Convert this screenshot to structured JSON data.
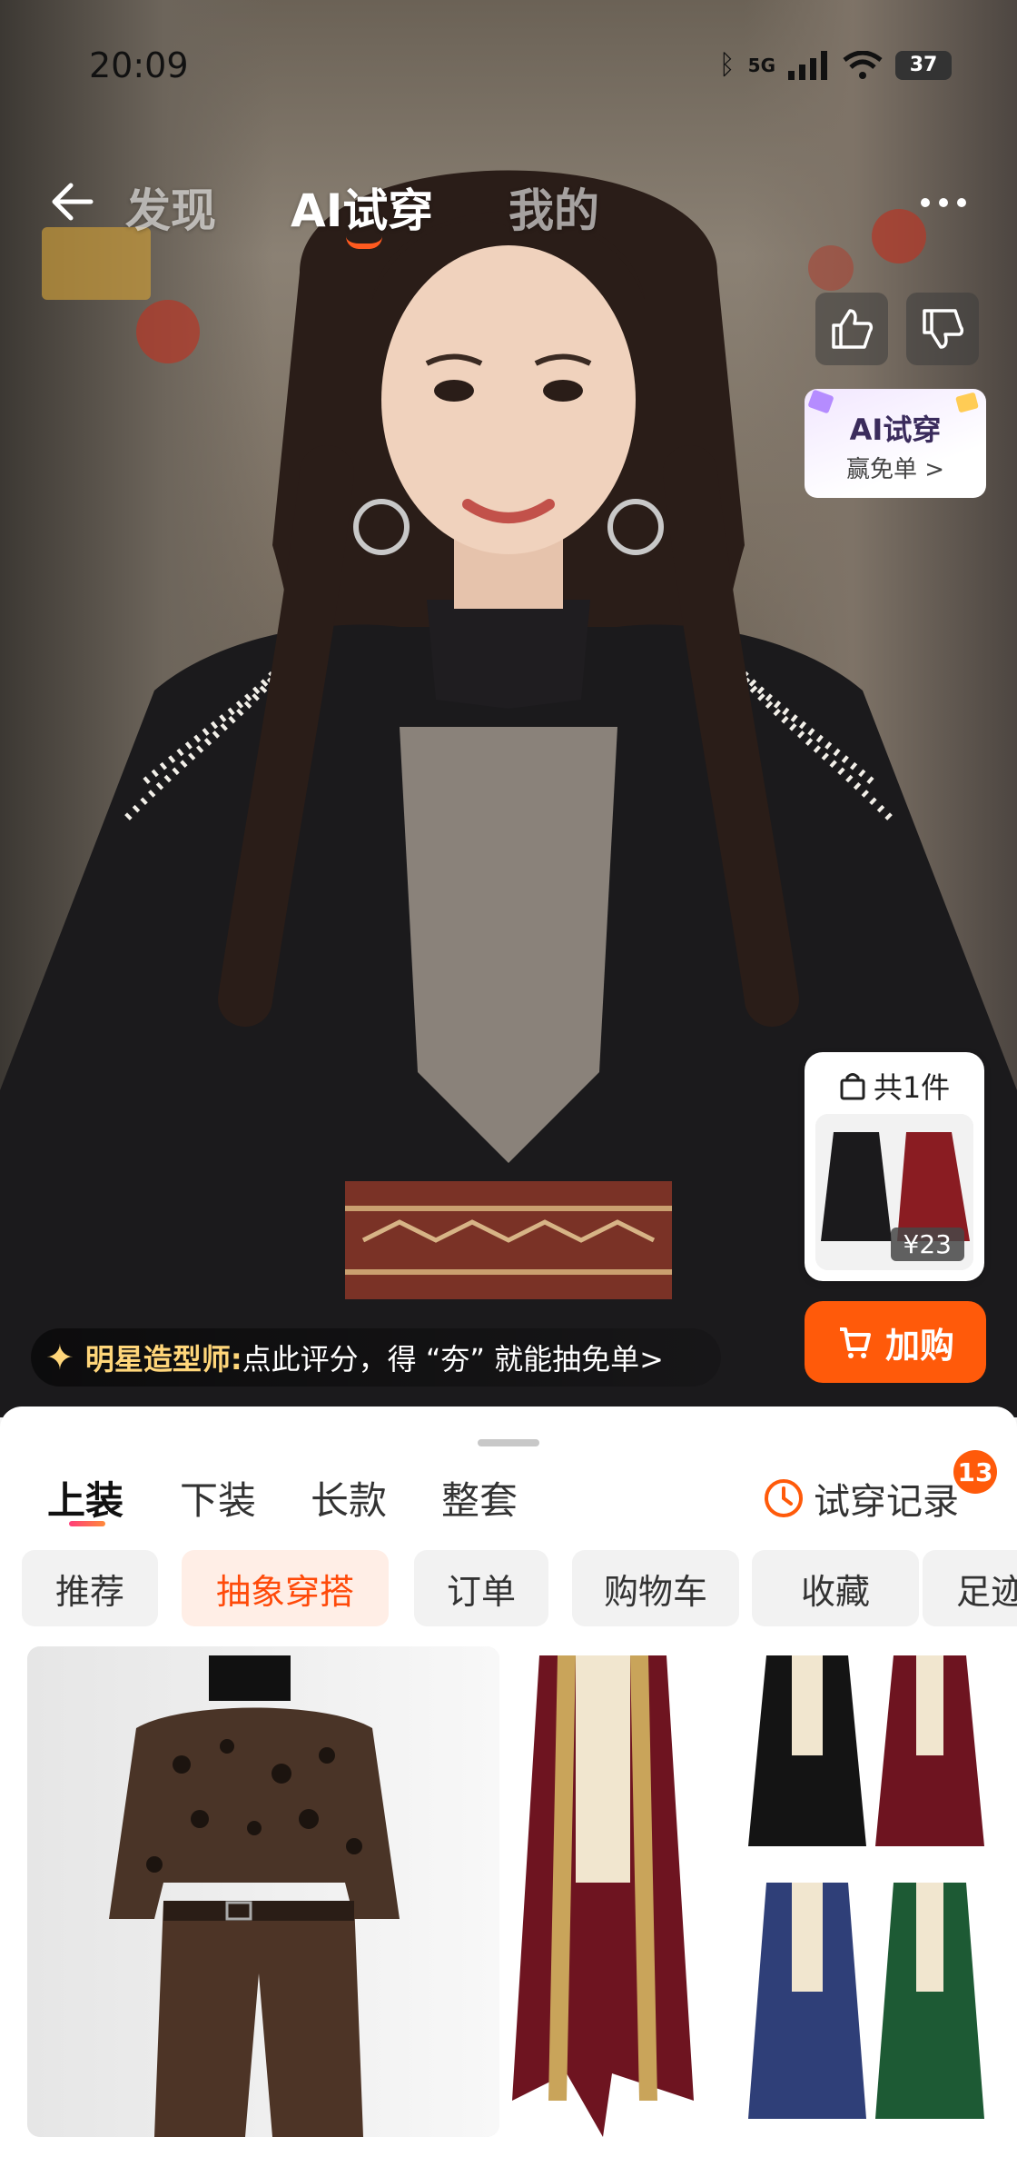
{
  "status_bar": {
    "time": "20:09",
    "network": "5G",
    "battery": "37"
  },
  "top_nav": {
    "tabs": [
      {
        "label": "发现"
      },
      {
        "label": "AI试穿"
      },
      {
        "label": "我的"
      }
    ],
    "active_tab": "AI试穿"
  },
  "promo_card": {
    "title": "AI试穿",
    "subtitle": "赢免单 >"
  },
  "cart_card": {
    "count_label": "共1件",
    "price": "¥23"
  },
  "add_to_cart": {
    "label": "加购"
  },
  "stylist_bar": {
    "who": "明星造型师:",
    "message": "点此评分，得 “夯” 就能抽免单>"
  },
  "sheet": {
    "category_tabs": [
      {
        "label": "上装"
      },
      {
        "label": "下装"
      },
      {
        "label": "长款"
      },
      {
        "label": "整套"
      }
    ],
    "active_category": "上装",
    "history": {
      "label": "试穿记录",
      "badge": "13"
    },
    "chips": [
      {
        "label": "推荐"
      },
      {
        "label": "抽象穿搭"
      },
      {
        "label": "订单"
      },
      {
        "label": "购物车"
      },
      {
        "label": "收藏"
      },
      {
        "label": "足迹"
      }
    ],
    "active_chip": "抽象穿搭"
  },
  "colors": {
    "accent": "#ff5a0a",
    "chip_active_bg": "#ffeee6",
    "chip_active_text": "#ff4a0a"
  },
  "icons": [
    "back-arrow-icon",
    "more-icon",
    "thumbs-up-icon",
    "thumbs-down-icon",
    "shopping-bag-icon",
    "cart-icon",
    "clock-icon",
    "sparkle-icon"
  ]
}
